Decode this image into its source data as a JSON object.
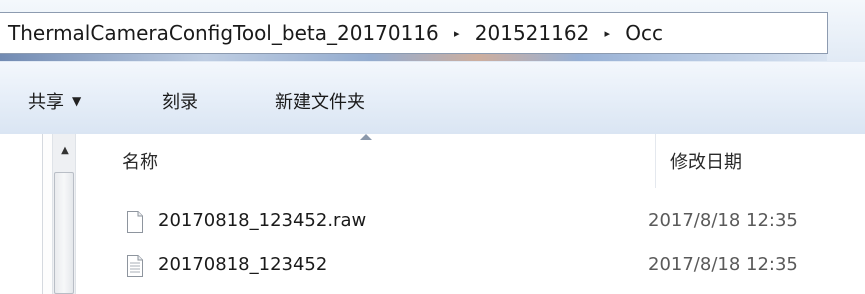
{
  "address": {
    "crumbs": [
      "ThermalCameraConfigTool_beta_20170116",
      "201521162",
      "Occ"
    ],
    "separator": "▸"
  },
  "toolbar": {
    "share_label": "共享",
    "burn_label": "刻录",
    "new_folder_label": "新建文件夹"
  },
  "columns": {
    "name": "名称",
    "date_modified": "修改日期"
  },
  "files": [
    {
      "name": "20170818_123452.raw",
      "date": "2017/8/18 12:35",
      "icon": "blank-file-icon"
    },
    {
      "name": "20170818_123452",
      "date": "2017/8/18 12:35",
      "icon": "text-file-icon"
    }
  ]
}
